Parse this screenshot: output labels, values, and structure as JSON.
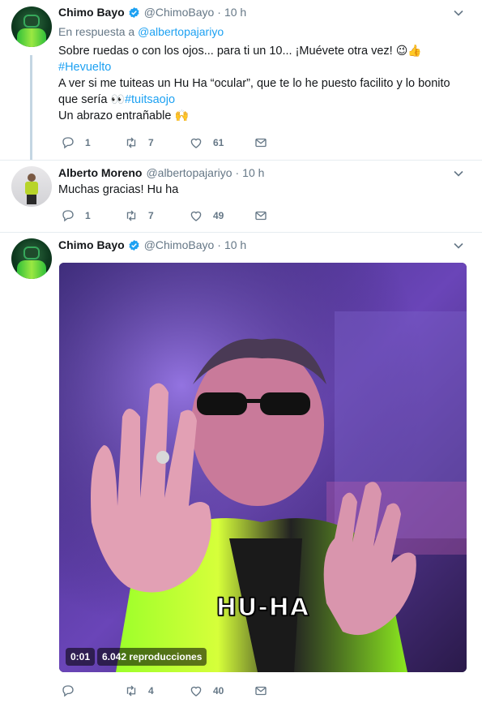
{
  "tweets": [
    {
      "name": "Chimo Bayo",
      "handle": "@ChimoBayo",
      "time": "10 h",
      "reply_prefix": "En respuesta a",
      "reply_handle": "@albertopajariyo",
      "line1": "Sobre ruedas o con los ojos... para ti un 10... ¡Muévete otra vez!",
      "line1_emoji": "😉👍",
      "hashtag1": "#Hevuelto",
      "line2": "A ver si me tuiteas un Hu Ha “ocular”, que te lo he puesto facilito y lo bonito",
      "line3": "que sería",
      "line3_emoji": "👀",
      "hashtag2": "#tuitsaojo",
      "line4": "Un abrazo entrañable",
      "line4_emoji": "🙌",
      "replies": "1",
      "retweets": "7",
      "likes": "61"
    },
    {
      "name": "Alberto Moreno",
      "handle": "@albertopajariyo",
      "time": "10 h",
      "text": "Muchas gracias! Hu ha",
      "replies": "1",
      "retweets": "7",
      "likes": "49"
    },
    {
      "name": "Chimo Bayo",
      "handle": "@ChimoBayo",
      "time": "10 h",
      "video_caption": "HU-HA",
      "video_time": "0:01",
      "video_views": "6.042 reproducciones",
      "retweets": "4",
      "likes": "40"
    }
  ],
  "colors": {
    "link": "#1da1f2",
    "muted": "#657786",
    "verified": "#1da1f2",
    "thread_line": "#c4d6e3"
  },
  "icons": [
    "reply-icon",
    "retweet-icon",
    "like-icon",
    "message-icon",
    "verified-icon",
    "chevron-down-icon"
  ]
}
